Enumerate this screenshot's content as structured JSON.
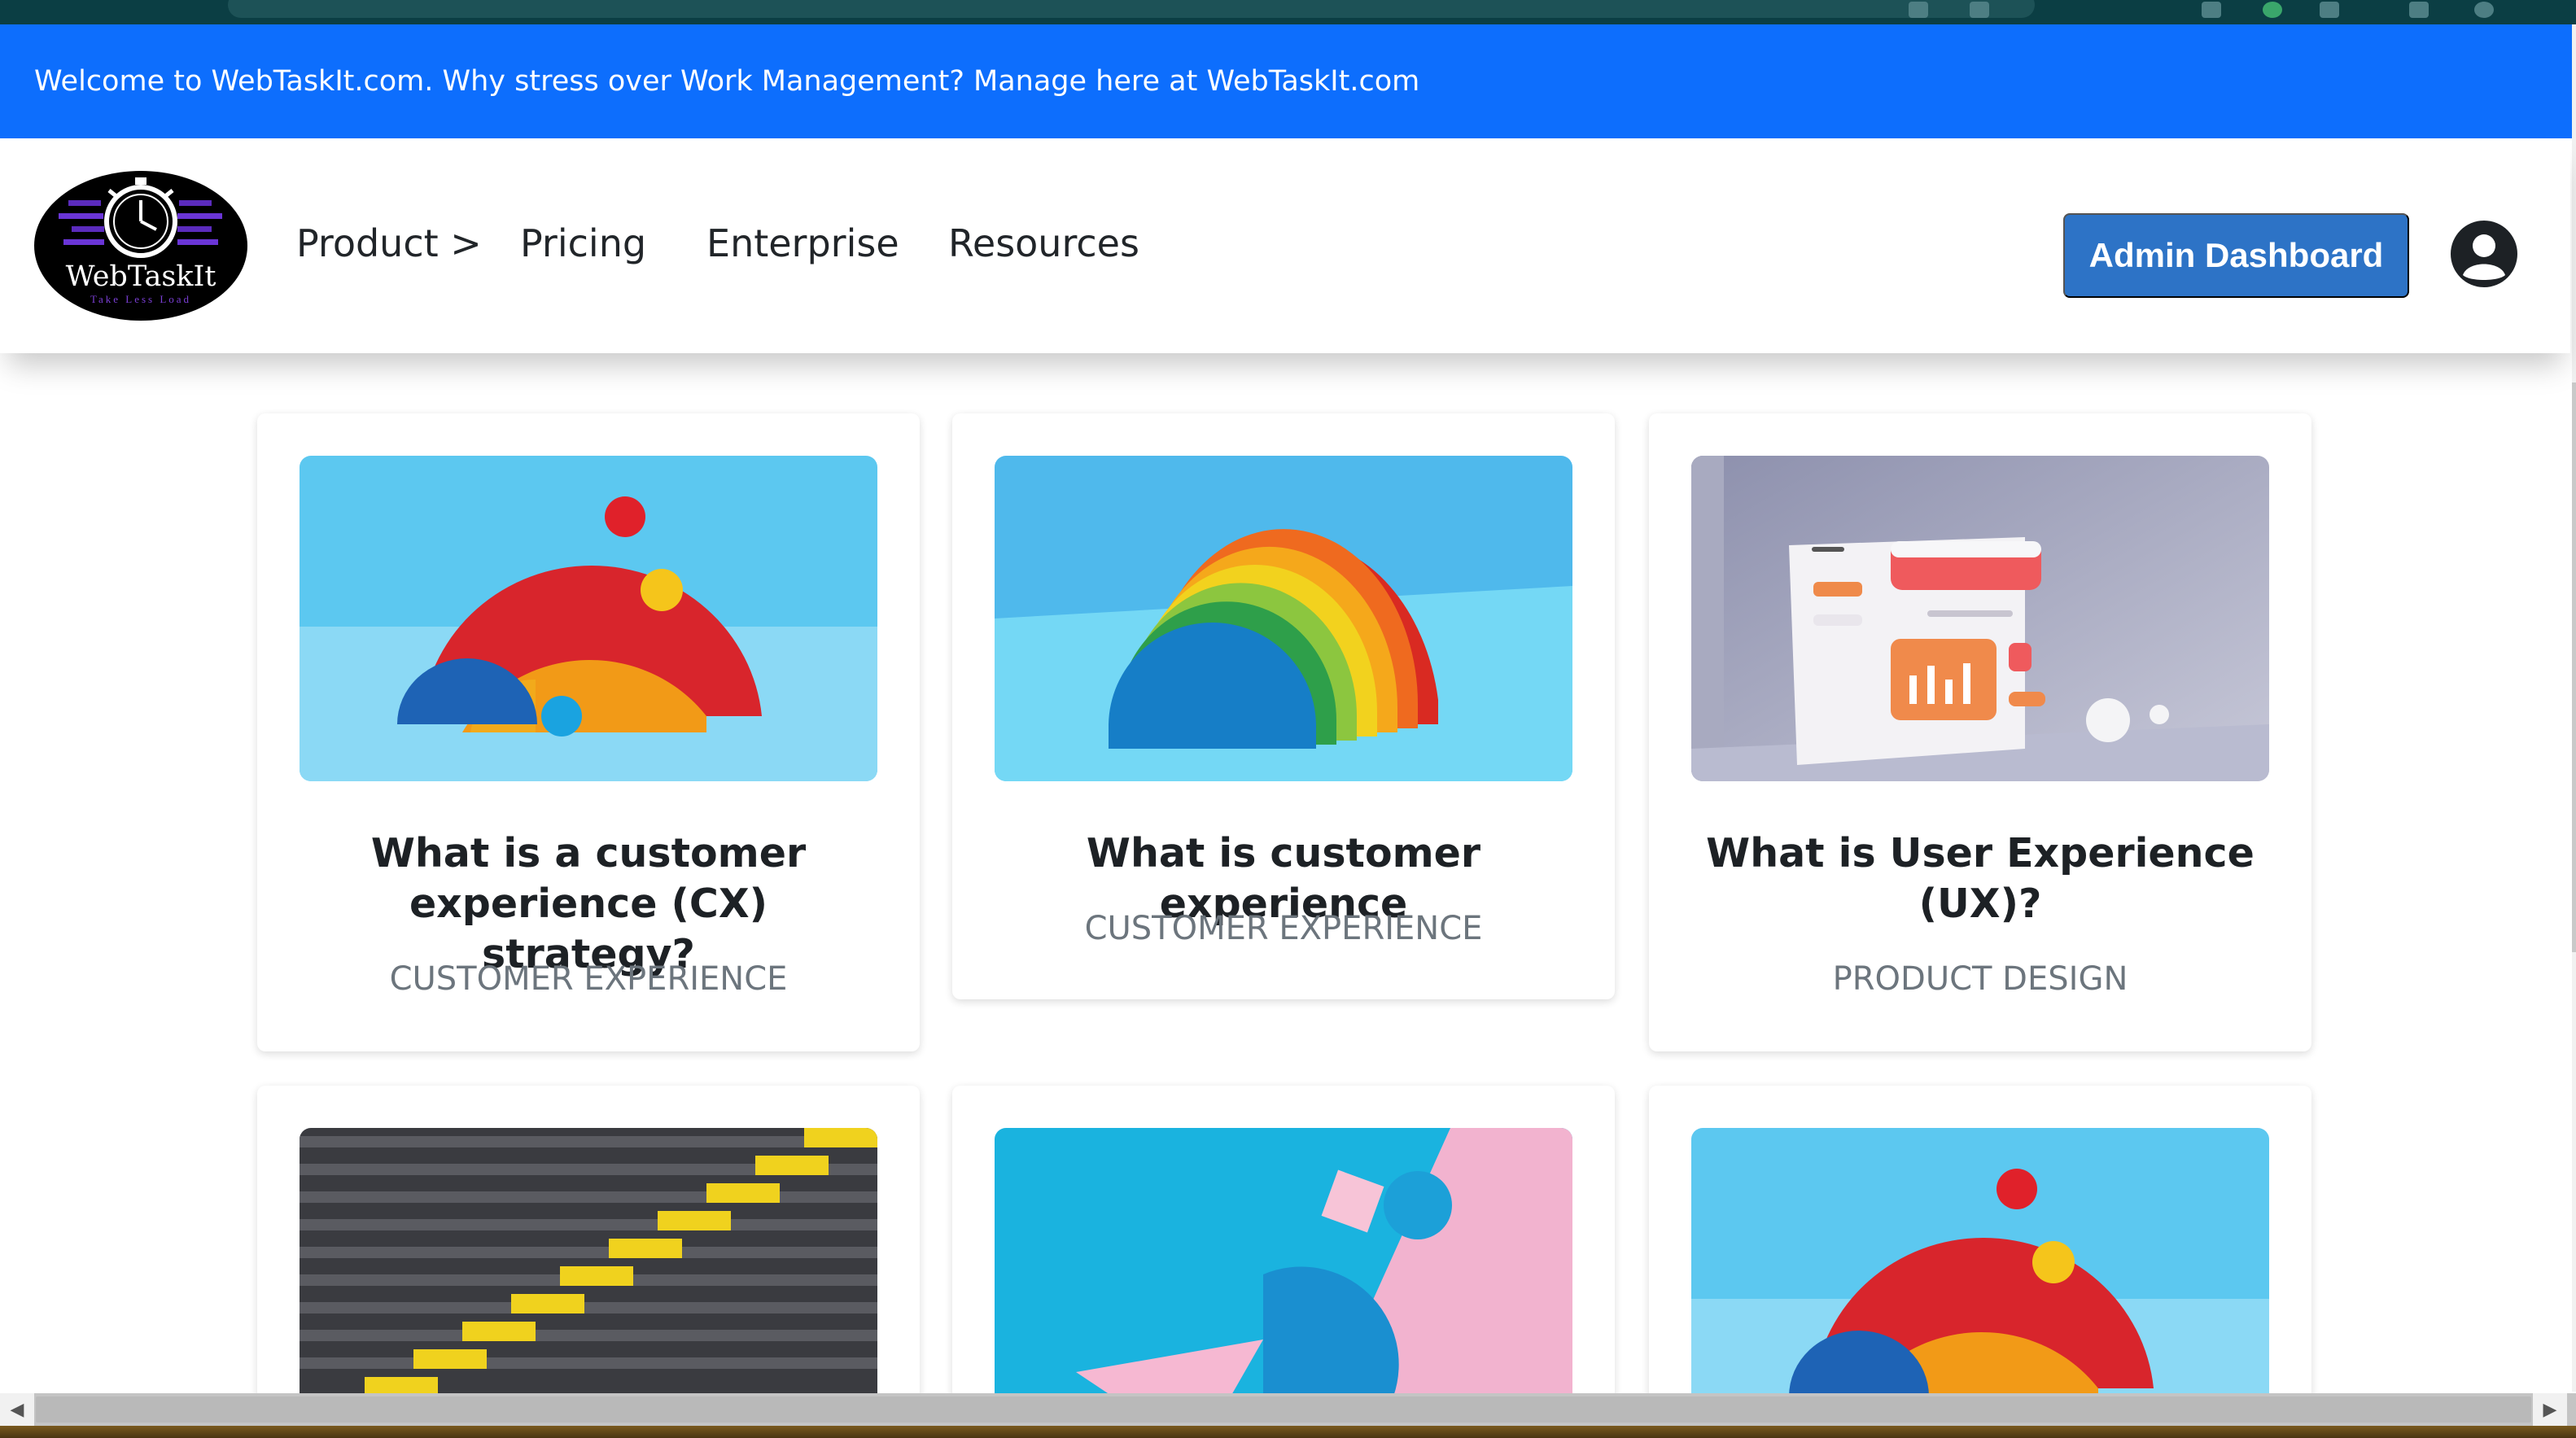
{
  "announcement": "Welcome to WebTaskIt.com. Why stress over Work Management? Manage here at WebTaskIt.com",
  "logo": {
    "name": "WebTaskIt",
    "tagline": "Take Less Load"
  },
  "nav": [
    {
      "label": "Product >"
    },
    {
      "label": "Pricing"
    },
    {
      "label": "Enterprise"
    },
    {
      "label": "Resources"
    }
  ],
  "admin_button": "Admin Dashboard",
  "colors": {
    "announce_bg": "#0d6efd",
    "admin_button_bg": "#2d73c6",
    "category_text": "#6c757d"
  },
  "cards": [
    {
      "title": "What is a customer experience (CX) strategy?",
      "category": "Customer Experience",
      "image": "red-yellow-semicircles-blue-background"
    },
    {
      "title": "What is customer experience",
      "category": "Customer Experience",
      "image": "wooden-rainbow-stacker"
    },
    {
      "title": "What is User Experience (UX)?",
      "category": "Product Design",
      "image": "3d-dashboard-window-illustration"
    },
    {
      "title": "",
      "category": "",
      "image": "grey-stairs-with-yellow-stripe"
    },
    {
      "title": "",
      "category": "",
      "image": "pink-blue-geometric-shapes"
    },
    {
      "title": "",
      "category": "",
      "image": "red-yellow-semicircles-blue-background"
    }
  ]
}
